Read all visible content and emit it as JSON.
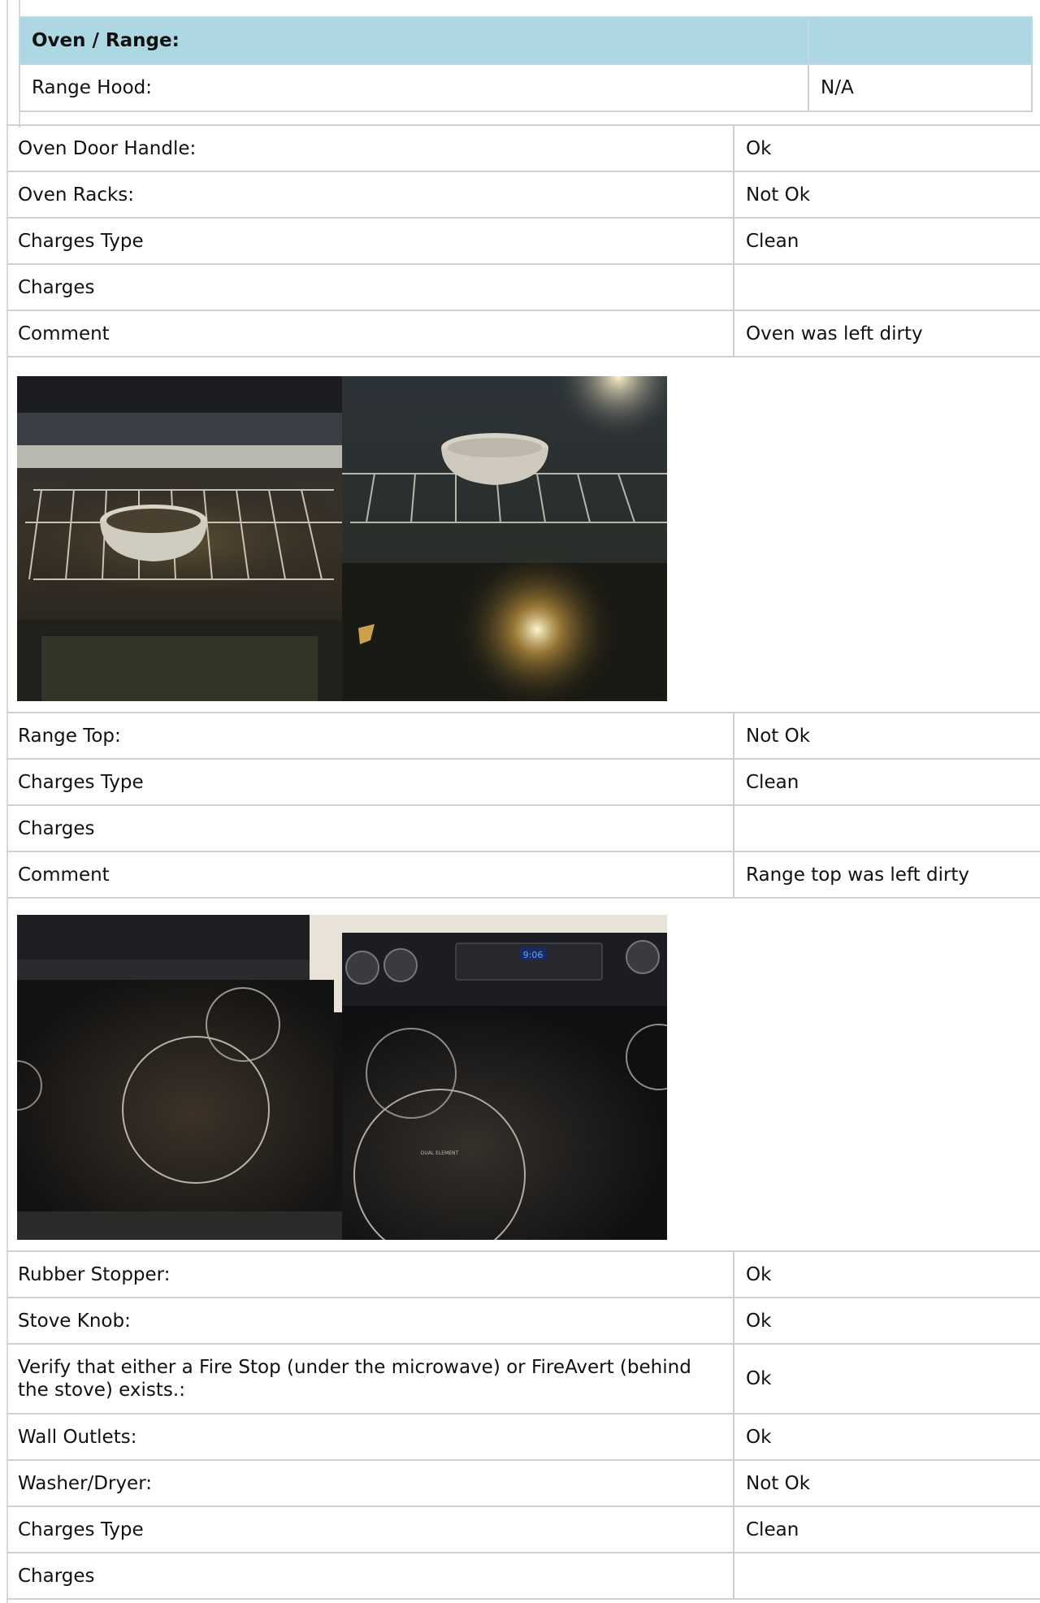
{
  "section": {
    "title": "Oven / Range:",
    "header_value": "",
    "range_hood_label": "Range Hood:",
    "range_hood_value": "N/A"
  },
  "oven": {
    "rows": [
      {
        "label": "Oven Door Handle:",
        "value": "Ok"
      },
      {
        "label": "Oven Racks:",
        "value": "Not Ok"
      },
      {
        "label": "Charges Type",
        "value": "Clean"
      },
      {
        "label": "Charges",
        "value": ""
      },
      {
        "label": "Comment",
        "value": "Oven was left dirty"
      }
    ]
  },
  "range_top": {
    "rows": [
      {
        "label": "Range Top:",
        "value": "Not Ok"
      },
      {
        "label": "Charges Type",
        "value": "Clean"
      },
      {
        "label": "Charges",
        "value": ""
      },
      {
        "label": "Comment",
        "value": "Range top was left dirty"
      }
    ]
  },
  "misc": {
    "rows": [
      {
        "label": "Rubber Stopper:",
        "value": "Ok"
      },
      {
        "label": "Stove Knob:",
        "value": "Ok"
      },
      {
        "label": "Verify that either a Fire Stop (under the microwave) or FireAvert (behind the stove) exists.:",
        "value": "Ok"
      },
      {
        "label": "Wall Outlets:",
        "value": "Ok"
      },
      {
        "label": "Washer/Dryer:",
        "value": "Not Ok"
      },
      {
        "label": "Charges Type",
        "value": "Clean"
      },
      {
        "label": "Charges",
        "value": ""
      }
    ]
  },
  "photo_text": {
    "display_time": "9:06",
    "element_label": "DUAL ELEMENT"
  }
}
